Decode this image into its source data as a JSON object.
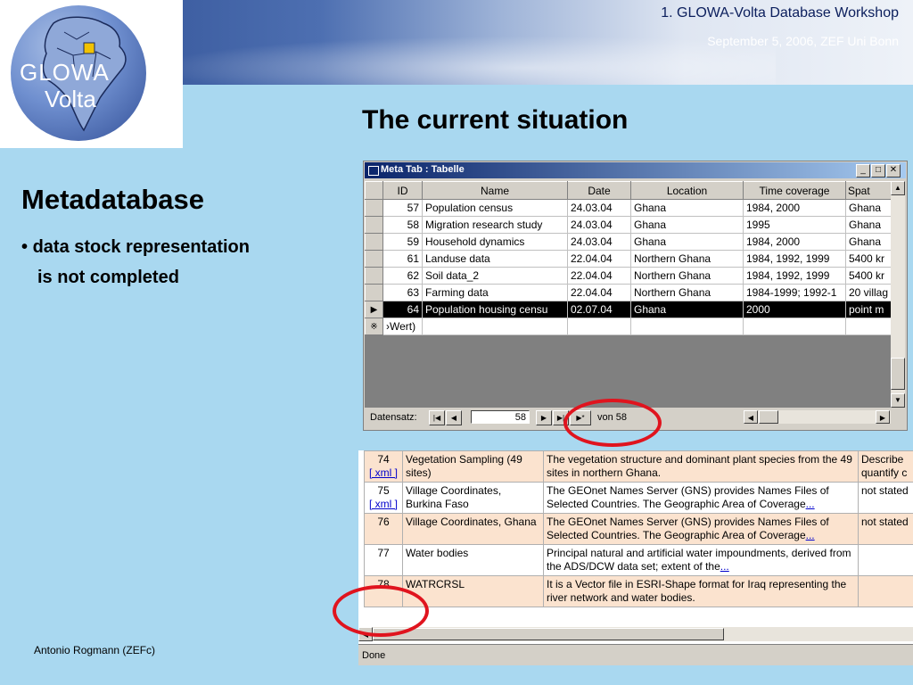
{
  "header": {
    "title": "1. GLOWA-Volta Database Workshop",
    "subtitle": "September 5, 2006, ZEF Uni Bonn",
    "logo_line1": "GLOWA",
    "logo_line2": "Volta"
  },
  "slide": {
    "title": "The current situation",
    "heading": "Metadatabase",
    "bullet_line1": "data stock representation",
    "bullet_line2": "is not completed",
    "author": "Antonio Rogmann (ZEFc)"
  },
  "access_window": {
    "title": "Meta Tab : Tabelle",
    "columns": [
      "ID",
      "Name",
      "Date",
      "Location",
      "Time coverage",
      "Spat"
    ],
    "rows": [
      {
        "id": "57",
        "name": "Population census",
        "date": "24.03.04",
        "location": "Ghana",
        "time": "1984, 2000",
        "spat": "Ghana"
      },
      {
        "id": "58",
        "name": "Migration research study",
        "date": "24.03.04",
        "location": "Ghana",
        "time": "1995",
        "spat": "Ghana"
      },
      {
        "id": "59",
        "name": "Household dynamics",
        "date": "24.03.04",
        "location": "Ghana",
        "time": "1984, 2000",
        "spat": "Ghana"
      },
      {
        "id": "61",
        "name": "Landuse data",
        "date": "22.04.04",
        "location": "Northern Ghana",
        "time": "1984, 1992, 1999",
        "spat": "5400 kr"
      },
      {
        "id": "62",
        "name": "Soil data_2",
        "date": "22.04.04",
        "location": "Northern Ghana",
        "time": "1984, 1992, 1999",
        "spat": "5400 kr"
      },
      {
        "id": "63",
        "name": "Farming data",
        "date": "22.04.04",
        "location": "Northern Ghana",
        "time": "1984-1999; 1992-1",
        "spat": "20 villag"
      },
      {
        "id": "64",
        "name": "Population housing censu",
        "date": "02.07.04",
        "location": "Ghana",
        "time": "2000",
        "spat": "point m"
      }
    ],
    "new_row_marker": "※",
    "new_row_value": "›Wert)",
    "nav_label": "Datensatz:",
    "current_record": "58",
    "of_label": "von  58"
  },
  "web_table": {
    "xml_link": "[ xml ]",
    "rows": [
      {
        "id": "74",
        "xml": true,
        "name": "Vegetation Sampling (49 sites)",
        "desc": "The vegetation structure and dominant plant species from the 49 sites in northern Ghana.",
        "more": false,
        "extra": "Describe quantify c"
      },
      {
        "id": "75",
        "xml": true,
        "name": "Village Coordinates, Burkina Faso",
        "desc": "The GEOnet Names Server (GNS) provides Names Files of Selected Countries. The Geographic Area of Coverage",
        "more": true,
        "extra": "not stated"
      },
      {
        "id": "76",
        "xml": false,
        "name": "Village Coordinates, Ghana",
        "desc": "The GEOnet Names Server (GNS) provides Names Files of Selected Countries. The Geographic Area of Coverage",
        "more": true,
        "extra": "not stated"
      },
      {
        "id": "77",
        "xml": false,
        "name": "Water bodies",
        "desc": "Principal natural and artificial water impoundments, derived from the ADS/DCW data set; extent of the",
        "more": true,
        "extra": ""
      },
      {
        "id": "78",
        "xml": false,
        "name": "WATRCRSL",
        "desc": "It is a Vector file in ESRI-Shape format for Iraq representing the river network and water bodies.",
        "more": false,
        "extra": ""
      }
    ],
    "more_link": "...",
    "status": "Done"
  },
  "colors": {
    "slide_bg": "#a9d8f0",
    "highlight_circle": "#e0141e",
    "odd_row": "#fbe3cf"
  }
}
